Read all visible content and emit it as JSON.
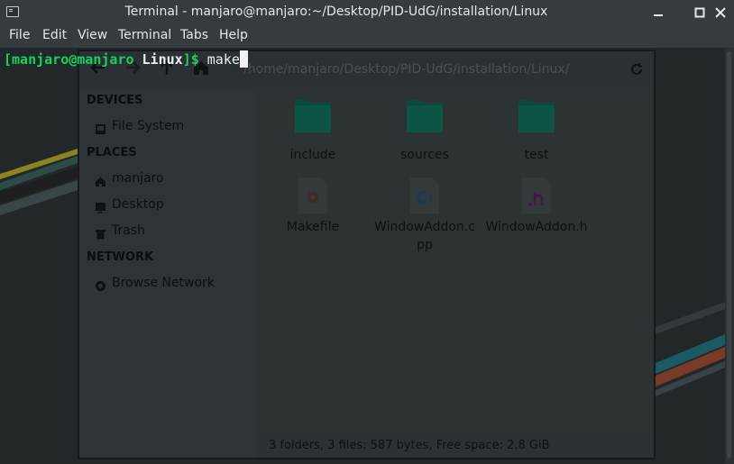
{
  "window": {
    "title": "Terminal - manjaro@manjaro:~/Desktop/PID-UdG/installation/Linux"
  },
  "menu": [
    "File",
    "Edit",
    "View",
    "Terminal",
    "Tabs",
    "Help"
  ],
  "prompt": {
    "bracket_open": "[",
    "user_host": "manjaro@manjaro",
    "directory": "Linux",
    "bracket_close": "]",
    "dollar": "$",
    "command": "make"
  },
  "file_manager": {
    "path": "/home/manjaro/Desktop/PID-UdG/installation/Linux/",
    "sidebar": {
      "devices_heading": "DEVICES",
      "places_heading": "PLACES",
      "network_heading": "NETWORK",
      "items": {
        "file_system": "File System",
        "home": "manjaro",
        "desktop": "Desktop",
        "trash": "Trash",
        "browse_network": "Browse Network"
      }
    },
    "files": [
      {
        "name": "include",
        "kind": "folder"
      },
      {
        "name": "sources",
        "kind": "folder"
      },
      {
        "name": "test",
        "kind": "folder"
      },
      {
        "name": "Makefile",
        "kind": "makefile"
      },
      {
        "name": "WindowAddon.cpp",
        "kind": "cpp-source"
      },
      {
        "name": "WindowAddon.h",
        "kind": "c-header"
      }
    ],
    "status": "3 folders, 3 files: 587 bytes, Free space: 2.8 GiB"
  },
  "colors": {
    "prompt_green": "#17d25c",
    "folder_teal": "#0a4a3c",
    "terminal_bg": "#22272a"
  }
}
